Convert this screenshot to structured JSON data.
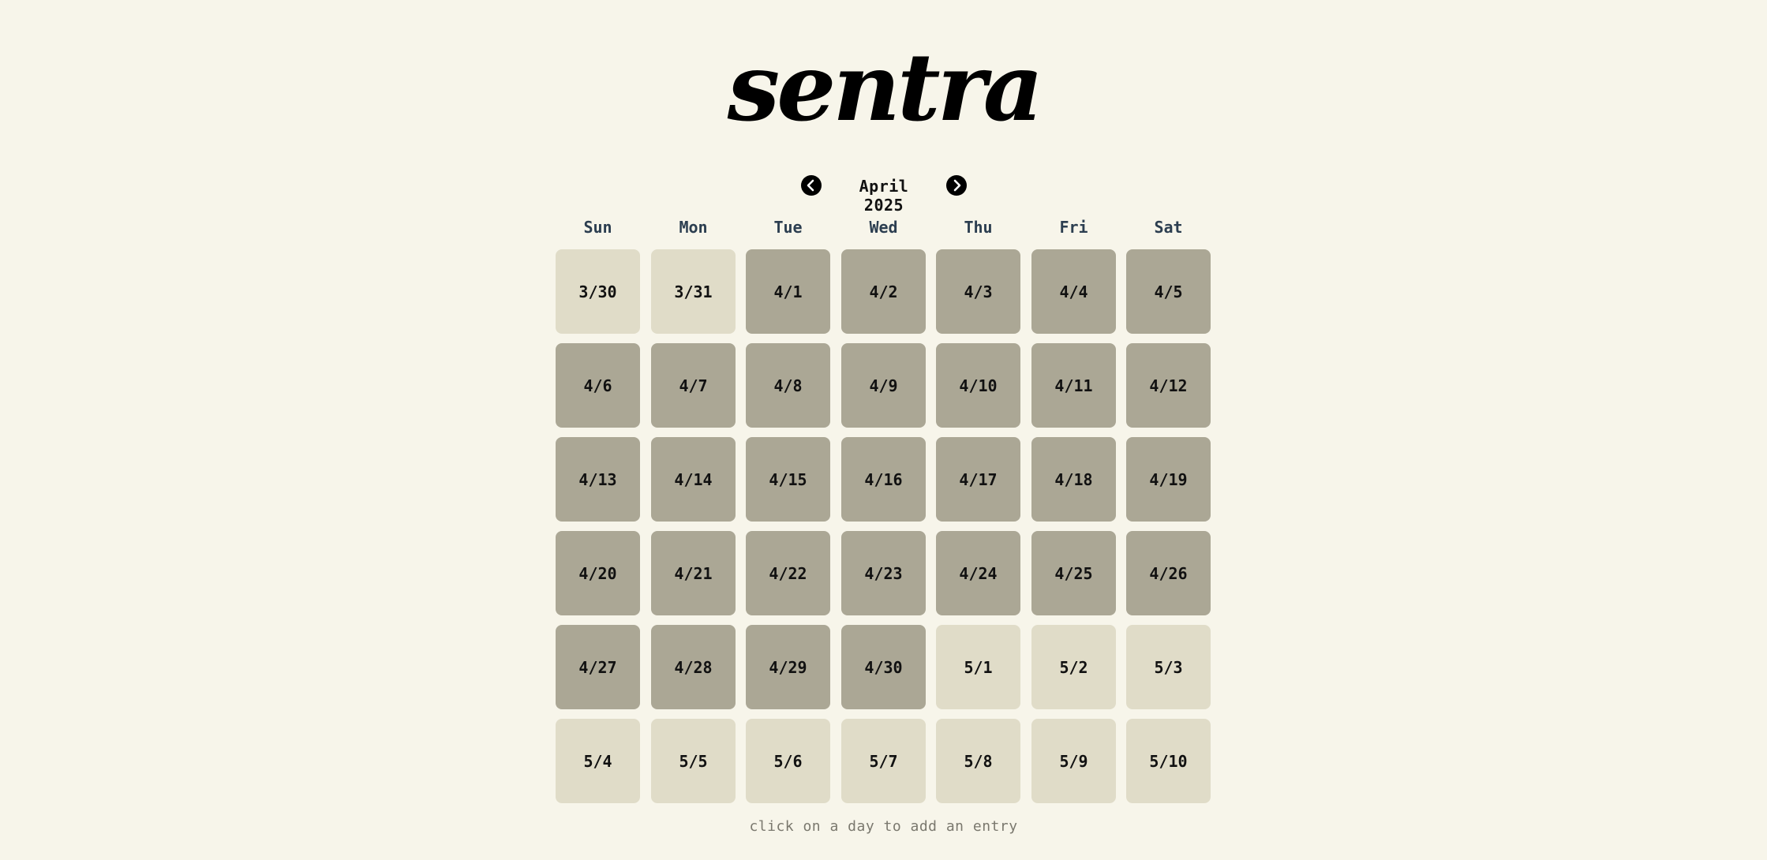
{
  "app": {
    "brand": "sentra"
  },
  "calendar": {
    "month_label": "April 2025",
    "weekdays": [
      "Sun",
      "Mon",
      "Tue",
      "Wed",
      "Thu",
      "Fri",
      "Sat"
    ],
    "days": [
      {
        "label": "3/30",
        "in_month": false
      },
      {
        "label": "3/31",
        "in_month": false
      },
      {
        "label": "4/1",
        "in_month": true
      },
      {
        "label": "4/2",
        "in_month": true
      },
      {
        "label": "4/3",
        "in_month": true
      },
      {
        "label": "4/4",
        "in_month": true
      },
      {
        "label": "4/5",
        "in_month": true
      },
      {
        "label": "4/6",
        "in_month": true
      },
      {
        "label": "4/7",
        "in_month": true
      },
      {
        "label": "4/8",
        "in_month": true
      },
      {
        "label": "4/9",
        "in_month": true
      },
      {
        "label": "4/10",
        "in_month": true
      },
      {
        "label": "4/11",
        "in_month": true
      },
      {
        "label": "4/12",
        "in_month": true
      },
      {
        "label": "4/13",
        "in_month": true
      },
      {
        "label": "4/14",
        "in_month": true
      },
      {
        "label": "4/15",
        "in_month": true
      },
      {
        "label": "4/16",
        "in_month": true
      },
      {
        "label": "4/17",
        "in_month": true
      },
      {
        "label": "4/18",
        "in_month": true
      },
      {
        "label": "4/19",
        "in_month": true
      },
      {
        "label": "4/20",
        "in_month": true
      },
      {
        "label": "4/21",
        "in_month": true
      },
      {
        "label": "4/22",
        "in_month": true
      },
      {
        "label": "4/23",
        "in_month": true
      },
      {
        "label": "4/24",
        "in_month": true
      },
      {
        "label": "4/25",
        "in_month": true
      },
      {
        "label": "4/26",
        "in_month": true
      },
      {
        "label": "4/27",
        "in_month": true
      },
      {
        "label": "4/28",
        "in_month": true
      },
      {
        "label": "4/29",
        "in_month": true
      },
      {
        "label": "4/30",
        "in_month": true
      },
      {
        "label": "5/1",
        "in_month": false
      },
      {
        "label": "5/2",
        "in_month": false
      },
      {
        "label": "5/3",
        "in_month": false
      },
      {
        "label": "5/4",
        "in_month": false
      },
      {
        "label": "5/5",
        "in_month": false
      },
      {
        "label": "5/6",
        "in_month": false
      },
      {
        "label": "5/7",
        "in_month": false
      },
      {
        "label": "5/8",
        "in_month": false
      },
      {
        "label": "5/9",
        "in_month": false
      },
      {
        "label": "5/10",
        "in_month": false
      }
    ],
    "hint": "click on a day to add an entry"
  },
  "icons": {
    "prev": "chevron-left-icon",
    "next": "chevron-right-icon"
  },
  "colors": {
    "background": "#f7f5ea",
    "day_in_month": "#aba795",
    "day_out_of_month": "#e0dcc8",
    "text": "#111111",
    "weekday_text": "#2c3e50",
    "hint_text": "#7a786e"
  }
}
